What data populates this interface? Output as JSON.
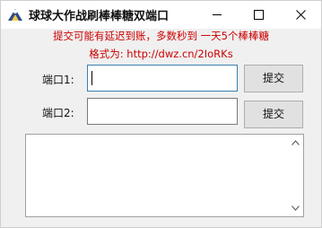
{
  "window": {
    "title": "球球大作战刷棒棒糖双端口",
    "controls": {
      "minimize": "minimize-icon",
      "maximize": "maximize-icon",
      "close": "close-icon"
    }
  },
  "notice": {
    "line1": "提交可能有延迟到账，多数秒到 一天5个棒棒糖",
    "line2": "格式为: http://dwz.cn/2IoRKs"
  },
  "ports": [
    {
      "label": "端口1:",
      "value": "",
      "submit_label": "提交"
    },
    {
      "label": "端口2:",
      "value": "",
      "submit_label": "提交"
    }
  ],
  "log": {
    "text": ""
  },
  "colors": {
    "notice": "#cc0000",
    "focus_border": "#3c7fb1",
    "window_bg": "#f0f0f0",
    "button_bg": "#e1e1e1"
  }
}
